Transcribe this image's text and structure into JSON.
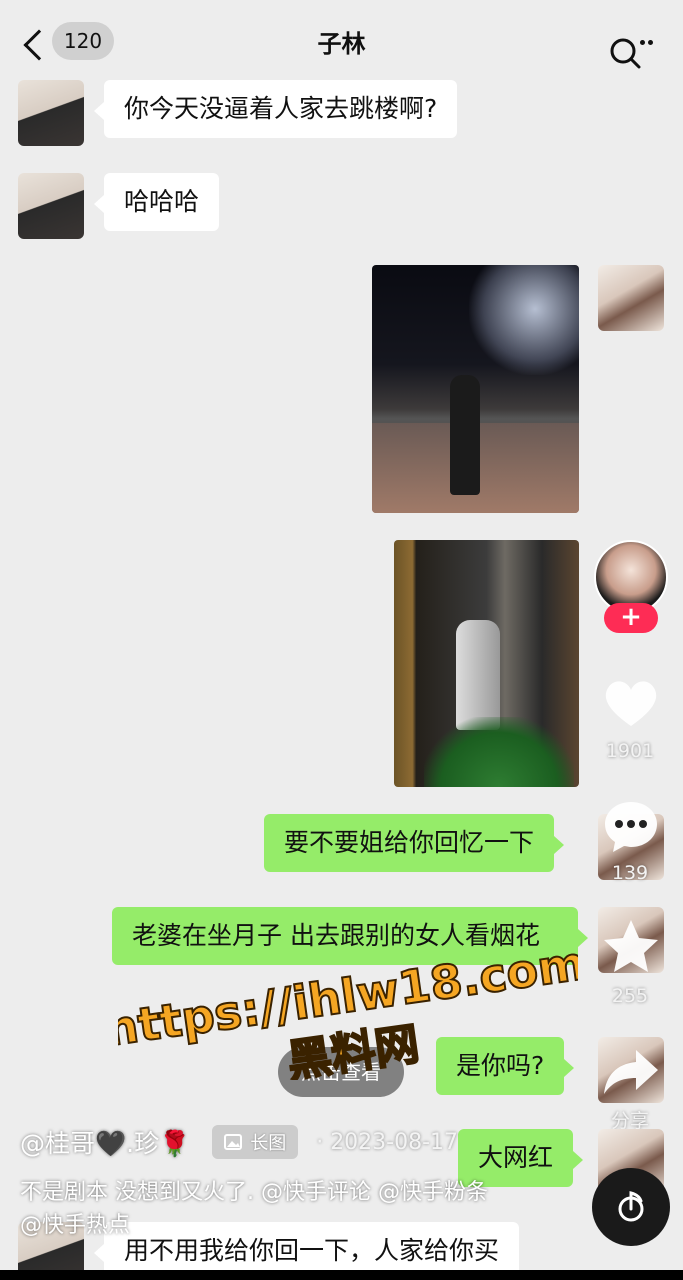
{
  "header": {
    "unread_count": "120",
    "title": "子林"
  },
  "messages": [
    {
      "side": "left",
      "text": "你今天没逼着人家去跳楼啊?"
    },
    {
      "side": "left",
      "text": "哈哈哈"
    },
    {
      "side": "right",
      "type": "image",
      "description": ""
    },
    {
      "side": "right",
      "type": "image",
      "description": ""
    },
    {
      "side": "right",
      "text": "要不要姐给你回忆一下"
    },
    {
      "side": "right",
      "text": "老婆在坐月子  出去跟别的女人看烟花"
    },
    {
      "side": "right",
      "text": "是你吗?"
    },
    {
      "side": "right",
      "text": "大网红"
    },
    {
      "side": "left",
      "text": "用不用我给你回一下，人家给你买"
    }
  ],
  "rail": {
    "follow_symbol": "+",
    "likes": "1901",
    "comments": "139",
    "favorites": "255",
    "share_label": "分享"
  },
  "view_button": "点击查看",
  "post": {
    "username": "@桂哥🖤.珍🌹",
    "tag_label": "长图",
    "date": "· 2023-08-17",
    "caption": "不是剧本 没想到又火了. @快手评论 @快手粉条 @快手热点"
  },
  "watermark": {
    "url": "https://ihlw18.com",
    "name": "黑料网"
  },
  "colors": {
    "bubble_green": "#95ec69",
    "follow_red": "#fe2c55",
    "watermark_orange": "#f5a623"
  }
}
